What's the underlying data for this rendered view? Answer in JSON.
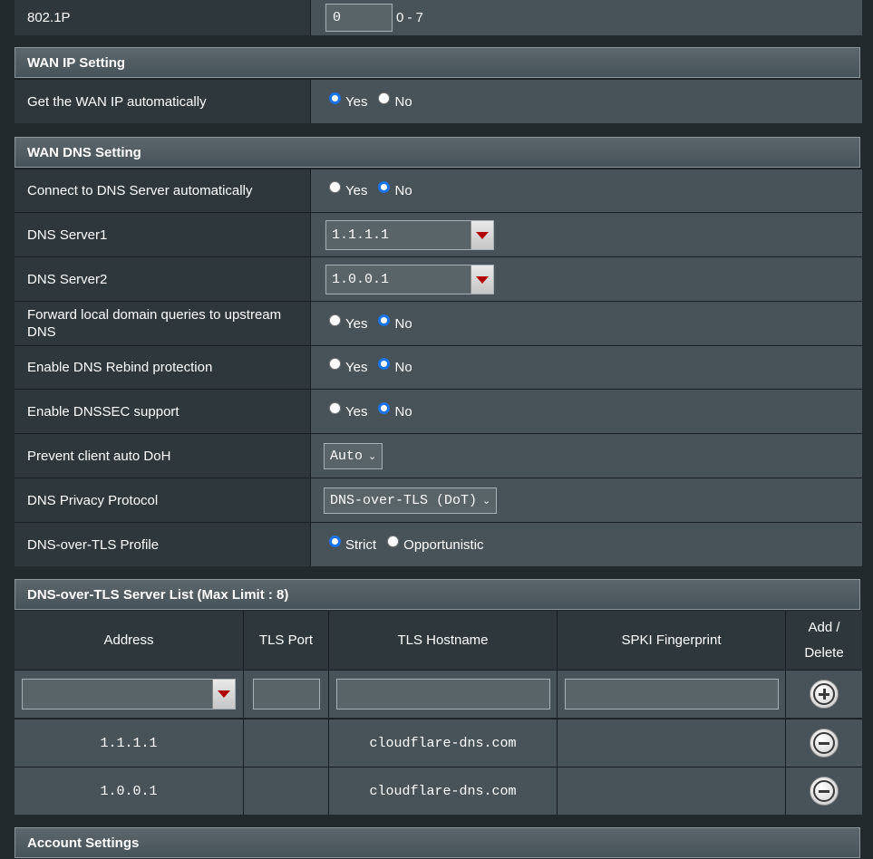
{
  "vlan": {
    "label": "802.1P",
    "value": "0",
    "range": "0 - 7"
  },
  "wan_ip": {
    "header": "WAN IP Setting",
    "auto_label": "Get the WAN IP automatically",
    "yes": "Yes",
    "no": "No",
    "selected": "Yes"
  },
  "wan_dns": {
    "header": "WAN DNS Setting",
    "connect_auto": {
      "label": "Connect to DNS Server automatically",
      "yes": "Yes",
      "no": "No",
      "selected": "No"
    },
    "dns1": {
      "label": "DNS Server1",
      "value": "1.1.1.1"
    },
    "dns2": {
      "label": "DNS Server2",
      "value": "1.0.0.1"
    },
    "forward_local": {
      "label": "Forward local domain queries to upstream DNS",
      "yes": "Yes",
      "no": "No",
      "selected": "No"
    },
    "rebind": {
      "label": "Enable DNS Rebind protection",
      "yes": "Yes",
      "no": "No",
      "selected": "No"
    },
    "dnssec": {
      "label": "Enable DNSSEC support",
      "yes": "Yes",
      "no": "No",
      "selected": "No"
    },
    "doh": {
      "label": "Prevent client auto DoH",
      "value": "Auto"
    },
    "privacy": {
      "label": "DNS Privacy Protocol",
      "value": "DNS-over-TLS (DoT)"
    },
    "dot_profile": {
      "label": "DNS-over-TLS Profile",
      "strict": "Strict",
      "opportunistic": "Opportunistic",
      "selected": "Strict"
    }
  },
  "dot_list": {
    "header": "DNS-over-TLS Server List (Max Limit : 8)",
    "columns": [
      "Address",
      "TLS Port",
      "TLS Hostname",
      "SPKI Fingerprint",
      "Add /",
      "Delete"
    ],
    "rows": [
      {
        "address": "1.1.1.1",
        "port": "",
        "hostname": "cloudflare-dns.com",
        "spki": ""
      },
      {
        "address": "1.0.0.1",
        "port": "",
        "hostname": "cloudflare-dns.com",
        "spki": ""
      }
    ]
  },
  "account": {
    "header": "Account Settings"
  },
  "colors": {
    "radio_selected": "#1a73e8",
    "dropdown_arrow": "#b10000"
  },
  "icons": [
    "dropdown-arrow-icon",
    "add-circle-icon",
    "remove-circle-icon",
    "chevron-down-icon"
  ]
}
